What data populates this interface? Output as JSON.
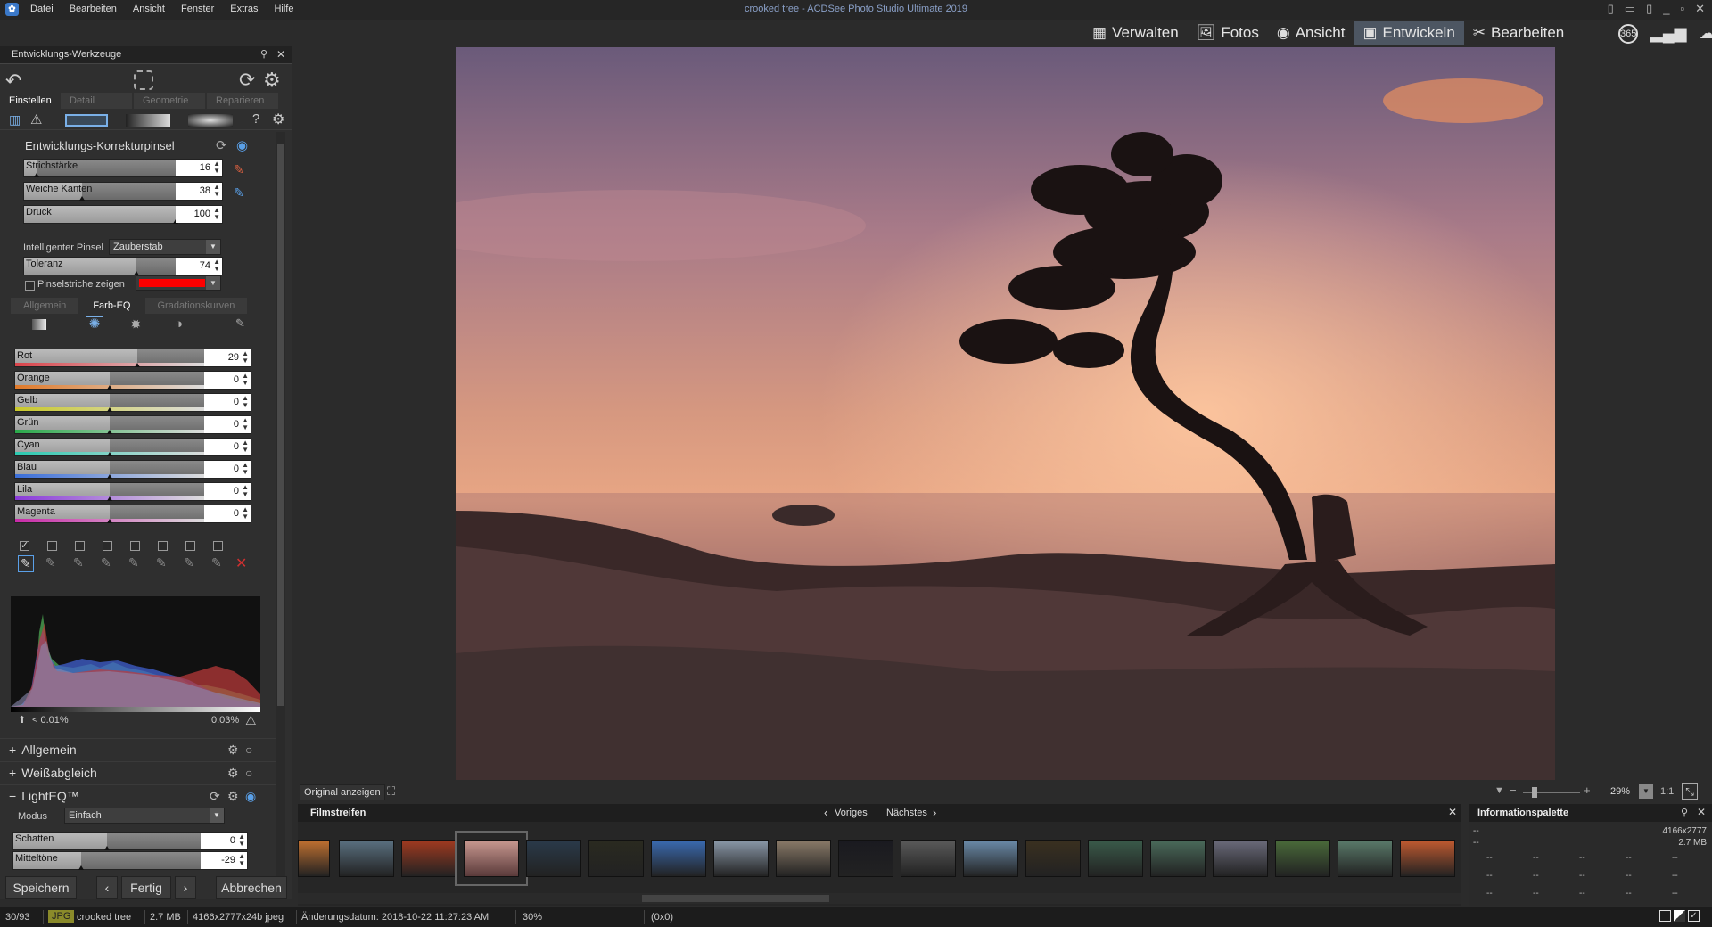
{
  "menu": {
    "app_icon": "ACDSee",
    "items": [
      "Datei",
      "Bearbeiten",
      "Ansicht",
      "Fenster",
      "Extras",
      "Hilfe"
    ]
  },
  "window_title": "crooked tree - ACDSee Photo Studio Ultimate 2019",
  "window_controls": {
    "minimize": "_",
    "maximize": "▫",
    "close": "✕"
  },
  "modes": [
    {
      "label": "Verwalten",
      "icon": "grid-icon"
    },
    {
      "label": "Fotos",
      "icon": "photos-icon"
    },
    {
      "label": "Ansicht",
      "icon": "eye-icon"
    },
    {
      "label": "Entwickeln",
      "icon": "develop-icon",
      "active": true
    },
    {
      "label": "Bearbeiten",
      "icon": "tools-icon"
    }
  ],
  "mode_extra": {
    "badge_365": "365"
  },
  "left_panel": {
    "title": "Entwicklungs-Werkzeuge",
    "tabs": [
      "Einstellen",
      "Detail",
      "Geometrie",
      "Reparieren"
    ],
    "active_tab": "Einstellen",
    "section_title": "Entwicklungs-Korrekturpinsel",
    "brush_sliders": [
      {
        "label": "Strichstärke",
        "value": "16",
        "level": 0.08
      },
      {
        "label": "Weiche Kanten",
        "value": "38",
        "level": 0.38
      },
      {
        "label": "Druck",
        "value": "100",
        "level": 1.0
      }
    ],
    "smart_brush": {
      "label": "Intelligenter Pinsel",
      "value": "Zauberstab"
    },
    "tolerance": {
      "label": "Toleranz",
      "value": "74",
      "level": 0.74
    },
    "show_strokes": {
      "label": "Pinselstriche zeigen",
      "checked": false,
      "color": "#ff0000"
    },
    "subtabs": [
      "Allgemein",
      "Farb-EQ",
      "Gradationskurven"
    ],
    "active_subtab": "Farb-EQ",
    "color_eq": [
      {
        "label": "Rot",
        "value": "29",
        "level": 0.645,
        "color": "#d9434a"
      },
      {
        "label": "Orange",
        "value": "0",
        "level": 0.5,
        "color": "#e07a2a"
      },
      {
        "label": "Gelb",
        "value": "0",
        "level": 0.5,
        "color": "#c9c92a"
      },
      {
        "label": "Grün",
        "value": "0",
        "level": 0.5,
        "color": "#2aa84a"
      },
      {
        "label": "Cyan",
        "value": "0",
        "level": 0.5,
        "color": "#2ac9b0"
      },
      {
        "label": "Blau",
        "value": "0",
        "level": 0.5,
        "color": "#3a6ed9"
      },
      {
        "label": "Lila",
        "value": "0",
        "level": 0.5,
        "color": "#8a3ad9"
      },
      {
        "label": "Magenta",
        "value": "0",
        "level": 0.5,
        "color": "#c92aa8"
      }
    ],
    "histogram": {
      "left": "< 0.01%",
      "right": "0.03%"
    },
    "sections": [
      "Allgemein",
      "Weißabgleich",
      "LightEQ™"
    ],
    "lighteq": {
      "mode_label": "Modus",
      "mode_value": "Einfach",
      "sliders": [
        {
          "label": "Schatten",
          "value": "0",
          "level": 0.5
        },
        {
          "label": "Mitteltöne",
          "value": "-29",
          "level": 0.36
        }
      ]
    },
    "buttons": {
      "save": "Speichern",
      "done": "Fertig",
      "cancel": "Abbrechen"
    }
  },
  "view_bar": {
    "original": "Original anzeigen",
    "zoom": "29%",
    "ratio": "1:1"
  },
  "filmstrip": {
    "title": "Filmstreifen",
    "prev": "Voriges",
    "next": "Nächstes",
    "thumb_colors": [
      "#c07030",
      "#5a7080",
      "#a03a20",
      "#7a6868",
      "#2a3a4a",
      "#2a2a20",
      "#3a6ab0",
      "#8a98a8",
      "#8a7a68",
      "#1a1a20",
      "#5a5a5a",
      "#6a8aa8",
      "#3a3020",
      "#3a5a4a",
      "#4a6a5a",
      "#6a6a7a",
      "#4a6a3a",
      "#5a7a6a",
      "#c05a30"
    ],
    "selected_index": 3
  },
  "info_panel": {
    "title": "Informationspalette",
    "dims": "4166x2777",
    "size": "2.7 MB",
    "placeholder": "--"
  },
  "statusbar": {
    "count": "30/93",
    "type": "JPG",
    "filename": "crooked tree",
    "size": "2.7 MB",
    "info": "4166x2777x24b jpeg",
    "date": "Änderungsdatum: 2018-10-22 11:27:23 AM",
    "zoom": "30%",
    "coords": "(0x0)"
  }
}
